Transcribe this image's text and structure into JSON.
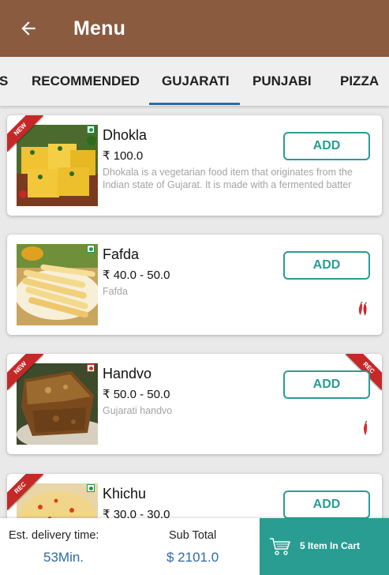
{
  "appbar": {
    "title": "Menu"
  },
  "tabs": [
    {
      "label": "S"
    },
    {
      "label": "RECOMMENDED"
    },
    {
      "label": "GUJARATI",
      "selected": true
    },
    {
      "label": "PUNJABI"
    },
    {
      "label": "PIZZA"
    }
  ],
  "items": [
    {
      "name": "Dhokla",
      "price": "₹ 100.0",
      "description": "Dhokala is a vegetarian food item that originates from the Indian state of Gujarat. It is made with a fermented batter",
      "ribbon_left": "NEW",
      "ribbon_right": "",
      "diet": "veg",
      "spicy": false,
      "add_label": "ADD"
    },
    {
      "name": "Fafda",
      "price": "₹ 40.0 - 50.0",
      "description": "Fafda",
      "ribbon_left": "",
      "ribbon_right": "",
      "diet": "veg",
      "spicy": true,
      "spice_icon": "two-chilies",
      "add_label": "ADD"
    },
    {
      "name": "Handvo",
      "price": "₹ 50.0 - 50.0",
      "description": "Gujarati handvo",
      "ribbon_left": "NEW",
      "ribbon_right": "REC",
      "diet": "non-veg",
      "spicy": true,
      "spice_icon": "one-chili",
      "add_label": "ADD"
    },
    {
      "name": "Khichu",
      "price": "₹ 30.0 - 30.0",
      "description": "",
      "ribbon_left": "REC",
      "ribbon_right": "",
      "diet": "veg",
      "spicy": false,
      "add_label": "ADD"
    }
  ],
  "footer": {
    "delivery_label": "Est. delivery time:",
    "delivery_value": "53Min.",
    "subtotal_label": "Sub Total",
    "subtotal_value": "$ 2101.0",
    "cart_label": "5 Item In Cart",
    "cart_icon": "shopping-cart-icon"
  },
  "colors": {
    "appbar": "#8b5b3f",
    "accent_teal": "#2a9d92",
    "accent_blue": "#2d6aa8",
    "ribbon_red": "#c62828",
    "veg_green": "#1a9b4b",
    "nonveg_red": "#d62b1f"
  }
}
